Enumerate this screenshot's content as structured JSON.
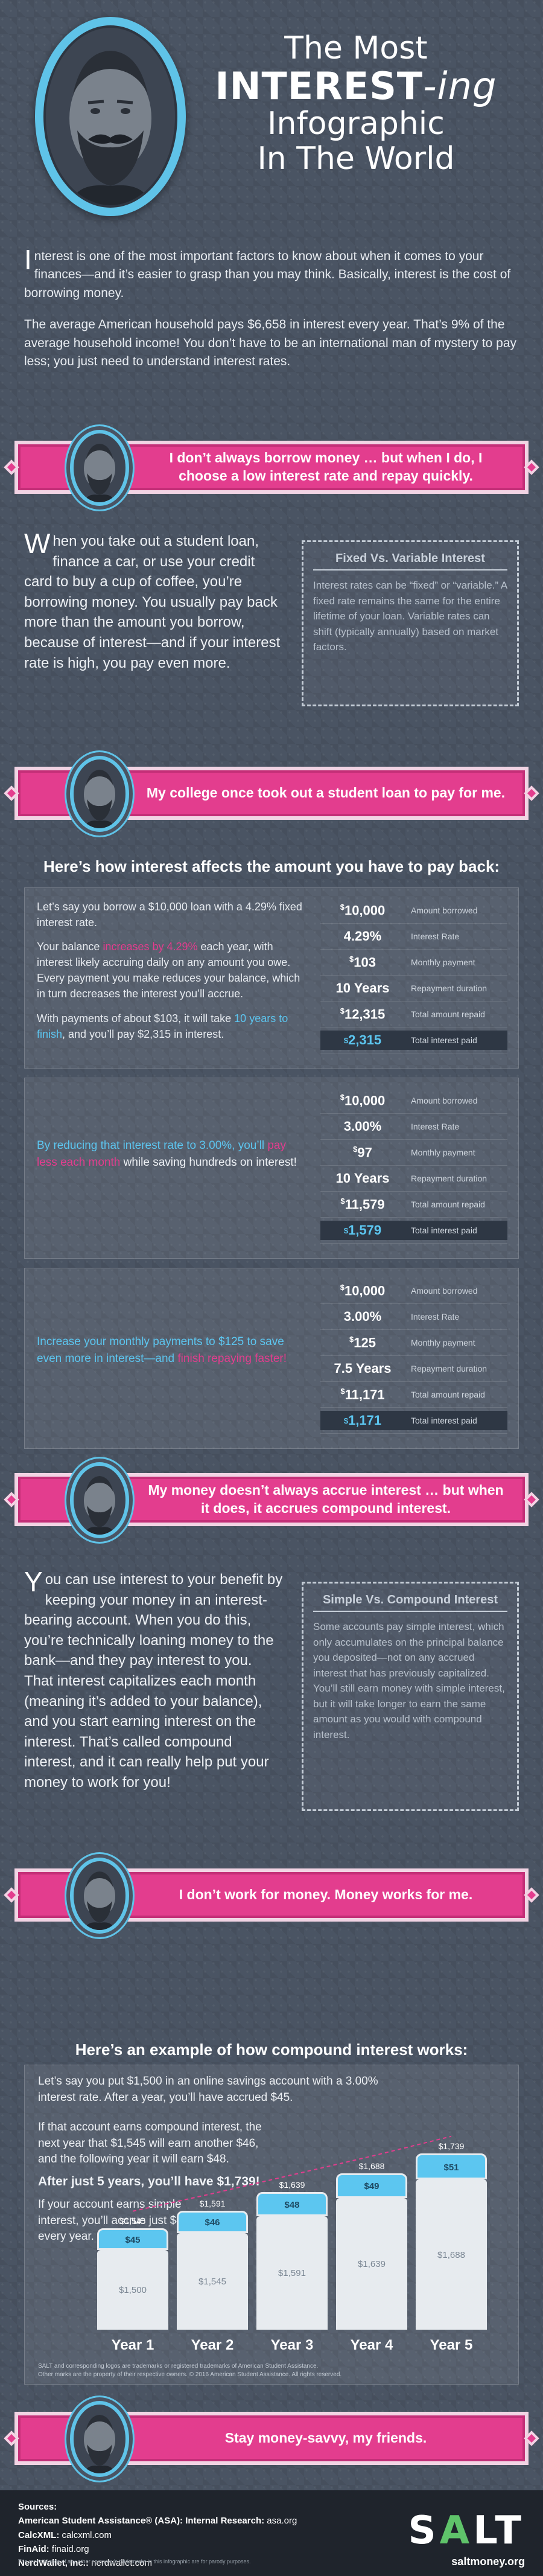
{
  "header": {
    "title_line1": "The Most",
    "title_line2_bold": "INTEREST",
    "title_line2_italic": "-ing",
    "title_line3": "Infographic",
    "title_line4": "In The World"
  },
  "intro": {
    "p1_dropcap": "I",
    "p1_rest": "nterest is one of the most important factors to know about when it comes to your finances—and it’s easier to grasp than you may think. Basically, interest is the cost of borrowing money.",
    "p2": "The average American household pays $6,658 in interest every year. That’s 9% of the average household income! You don’t have to be an international man of mystery to pay less; you just need to understand interest rates."
  },
  "banners": [
    "I don’t always borrow money … but when I do, I choose a low interest rate and repay quickly.",
    "My college once took out a student loan to pay for me.",
    "My money doesn’t always accrue interest … but when it does, it accrues compound interest.",
    "I don’t work for money. Money works for me.",
    "Stay money-savvy, my friends."
  ],
  "borrowing": {
    "lead_dropcap": "W",
    "lead_rest": "hen you take out a student loan, finance a car, or use your credit card to buy a cup of coffee, you’re borrowing money. You usually pay back more than the amount you borrow, because of interest—and if your interest rate is high, you pay even more.",
    "aside_title": "Fixed Vs. Variable Interest",
    "aside_body": "Interest rates can be “fixed” or “variable.” A fixed rate remains the same for the entire lifetime of your loan. Variable rates can shift (typically annually) based on market factors."
  },
  "payback": {
    "heading": "Here’s how interest affects the amount you have to pay back:",
    "s1_p1": "Let’s say you borrow a $10,000 loan with a 4.29% fixed interest rate.",
    "s1_p2a": "Your balance ",
    "s1_p2b": "increases by 4.29%",
    "s1_p2c": " each year, with interest likely accruing daily on any amount you owe. Every payment you make reduces your balance, which in turn decreases the interest you’ll accrue.",
    "s1_p3a": "With payments of about $103, it will take ",
    "s1_p3b": "10 years to finish",
    "s1_p3c": ", and you’ll pay $2,315 in interest.",
    "s2_a": "By reducing that interest rate to 3.00%, you’ll ",
    "s2_b": "pay less each month",
    "s2_c": " while saving hundreds on interest!",
    "s3_a": "Increase your monthly payments to $125 to save even more in interest—and ",
    "s3_b": "finish repaying faster!",
    "labels": [
      "Amount borrowed",
      "Interest Rate",
      "Monthly payment",
      "Repayment duration",
      "Total amount repaid",
      "Total interest paid"
    ],
    "scenarios": [
      {
        "values": [
          "10,000",
          "4.29%",
          "103",
          "10 Years",
          "12,315",
          "2,315"
        ]
      },
      {
        "values": [
          "10,000",
          "3.00%",
          "97",
          "10 Years",
          "11,579",
          "1,579"
        ]
      },
      {
        "values": [
          "10,000",
          "3.00%",
          "125",
          "7.5 Years",
          "11,171",
          "1,171"
        ]
      }
    ],
    "dollar": "$"
  },
  "compound": {
    "lead_dropcap": "Y",
    "lead_rest": "ou can use interest to your benefit by keeping your money in an interest-bearing account. When you do this, you’re technically loaning money to the bank—and they pay interest to you. That interest capitalizes each month (meaning it’s added to your balance), and you start earning interest on the interest. That’s called compound interest, and it can really help put your money to work for you!",
    "aside_title": "Simple Vs. Compound Interest",
    "aside_body": "Some accounts pay simple interest, which only accumulates on the principal balance you deposited—not on any accrued interest that has previously capitalized. You’ll still earn money with simple interest, but it will take longer to earn the same amount as you would with compound interest."
  },
  "example": {
    "heading": "Here’s an example of how compound interest works:",
    "t1": "Let’s say you put $1,500 in an online savings account with a 3.00% interest rate. After a year, you’ll have accrued $45.",
    "t2": "If that account earns compound interest, the next year that $1,545 will earn another $46, and the following year it will earn $48.",
    "t3": "After just 5 years, you’ll have $1,739!",
    "t4": "If your account earns simple interest, you’ll accrue just $45 every year.",
    "chart_data": {
      "type": "bar",
      "categories": [
        "Year 1",
        "Year 2",
        "Year 3",
        "Year 4",
        "Year 5"
      ],
      "series": [
        {
          "values": [
            1500,
            1545,
            1591,
            1639,
            1688
          ]
        },
        {
          "values": [
            45,
            46,
            48,
            49,
            51
          ]
        }
      ],
      "totals": [
        1545,
        1591,
        1639,
        1688,
        1739
      ],
      "base_labels": [
        "$1,500",
        "$1,545",
        "$1,591",
        "$1,639",
        "$1,688"
      ],
      "add_labels": [
        "$45",
        "$46",
        "$48",
        "$49",
        "$51"
      ],
      "total_labels": [
        "$1,545",
        "$1,591",
        "$1,639",
        "$1,688",
        "$1,739"
      ]
    },
    "footnote1": "SALT and corresponding logos are trademarks or registered trademarks of American Student Assistance.",
    "footnote2": "Other marks are the property of their respective owners. © 2016 American Student Assistance. All rights reserved."
  },
  "footer": {
    "sources_label": "Sources:",
    "s1_name": "American Student Assistance® (ASA): Internal Research:",
    "s1_val": "asa.org",
    "s2_name": "CalcXML:",
    "s2_val": "calcxml.com",
    "s3_name": "FinAid:",
    "s3_val": "finaid.org",
    "s4_name": "NerdWallet, Inc.:",
    "s4_val": "nerdwallet.com",
    "legal": "The resemblance of any other company’s trademarks in this infographic are for parody purposes.",
    "logo_s": "S",
    "logo_a": "A",
    "logo_lt": "LT",
    "site": "saltmoney.org"
  }
}
